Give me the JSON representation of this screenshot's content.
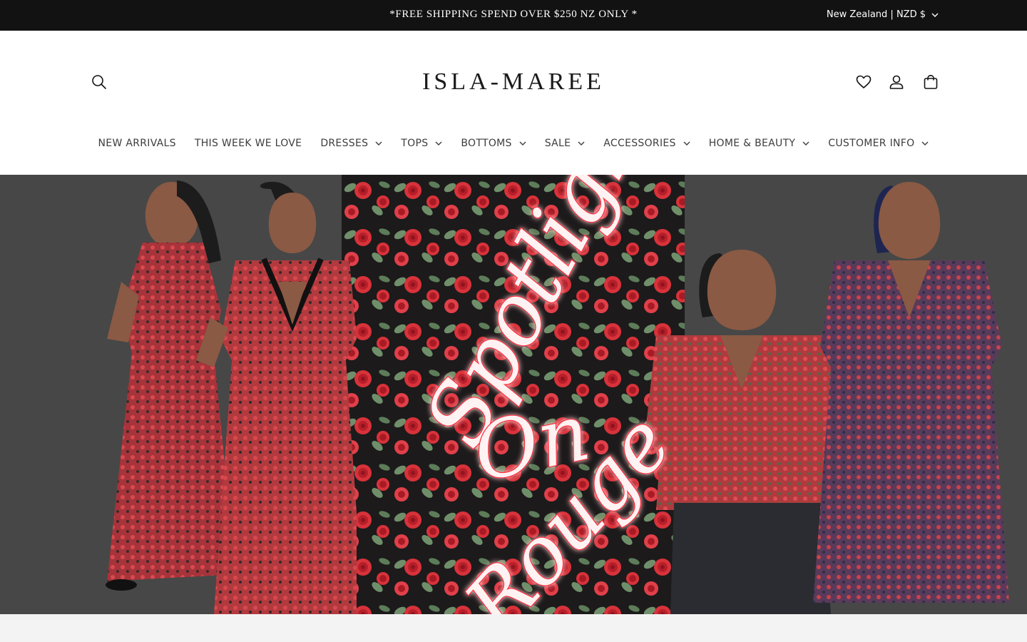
{
  "announcement": {
    "text": "*FREE SHIPPING SPEND OVER $250 NZ ONLY *",
    "locale": "New Zealand | NZD $"
  },
  "header": {
    "logo": "ISLA-MAREE",
    "icons": [
      "search-icon",
      "heart-icon",
      "user-icon",
      "bag-icon"
    ]
  },
  "nav": {
    "items": [
      {
        "label": "NEW ARRIVALS",
        "has_dropdown": false
      },
      {
        "label": "THIS WEEK WE LOVE",
        "has_dropdown": false
      },
      {
        "label": "DRESSES",
        "has_dropdown": true
      },
      {
        "label": "TOPS",
        "has_dropdown": true
      },
      {
        "label": "BOTTOMS",
        "has_dropdown": true
      },
      {
        "label": "SALE",
        "has_dropdown": true
      },
      {
        "label": "ACCESSORIES",
        "has_dropdown": true
      },
      {
        "label": "HOME & BEAUTY",
        "has_dropdown": true
      },
      {
        "label": "CUSTOMER INFO",
        "has_dropdown": true
      }
    ]
  },
  "hero": {
    "script_lines": [
      "Spotlight",
      "On",
      "Rouge"
    ]
  },
  "colors": {
    "announcement_bg": "#121212",
    "hero_bg": "#474747",
    "neon": "#ff2a3a",
    "floral_bg": "#1c1a1b",
    "rose": "#d8323a",
    "leaf": "#6f8f6a"
  }
}
